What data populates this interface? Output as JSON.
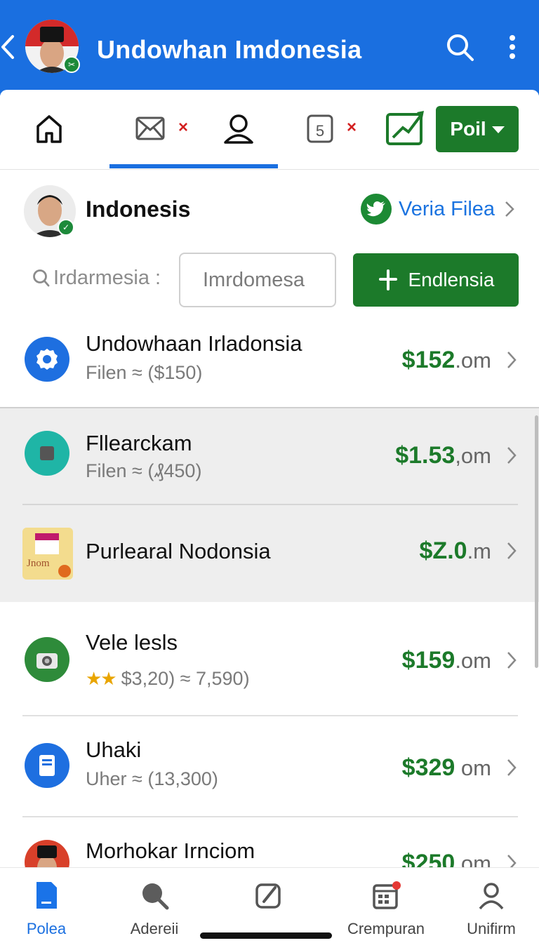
{
  "header": {
    "title": "Undowhan Imdonesia",
    "avatar_badge": "✂"
  },
  "toolbar": {
    "icons": [
      "home-icon",
      "mail-icon",
      "profile-icon",
      "calendar-icon",
      "chart-icon"
    ],
    "poll_label": "Poil"
  },
  "profile": {
    "name": "Indonesis",
    "verify_label": "Veria Filea"
  },
  "search": {
    "label": "Irdarmesia :",
    "placeholder": "Imrdomesa",
    "button_label": "Endlensia"
  },
  "items": [
    {
      "name": "Undowhaan Irladonsia",
      "sub": "Filen ≈ ($150)",
      "price": "$152",
      "unit": ".om",
      "icon": "gear-icon",
      "color": "#1e6fe0"
    },
    {
      "name": "Fllearckam",
      "sub": "Filen ≈ (₰450)",
      "price": "$1.53",
      "unit": ",om",
      "icon": "square-icon",
      "color": "#1fb5a6"
    },
    {
      "name": "Purlearal Nodonsia",
      "sub": "",
      "price": "$Z.0",
      "unit": ".m",
      "icon": "jnom-logo-icon",
      "color": "#f2dc8c"
    },
    {
      "name": "Vele lesls",
      "sub": "$3,20) ≈ 7,590)",
      "stars": "★★",
      "price": "$159",
      "unit": ".om",
      "icon": "camera-icon",
      "color": "#2e8b3a"
    },
    {
      "name": "Uhaki",
      "sub": "Uher ≈ (13,300)",
      "price": "$329",
      "unit": " om",
      "icon": "tablet-icon",
      "color": "#1e6fe0"
    },
    {
      "name": "Morhokar Irnciom",
      "sub": "",
      "price": "$250",
      "unit": ".om",
      "icon": "avatar-icon",
      "color": "#d8402a"
    }
  ],
  "bottom_nav": [
    {
      "label": "Polea",
      "icon": "document-icon"
    },
    {
      "label": "Adereii",
      "icon": "search-icon"
    },
    {
      "label": "",
      "icon": "edit-icon"
    },
    {
      "label": "Crempuran",
      "icon": "calendar-icon"
    },
    {
      "label": "Unifirm",
      "icon": "profile-icon"
    }
  ],
  "colors": {
    "primary_blue": "#1a6fe0",
    "accent_green": "#1c7a2a",
    "alert_red": "#d32020"
  }
}
